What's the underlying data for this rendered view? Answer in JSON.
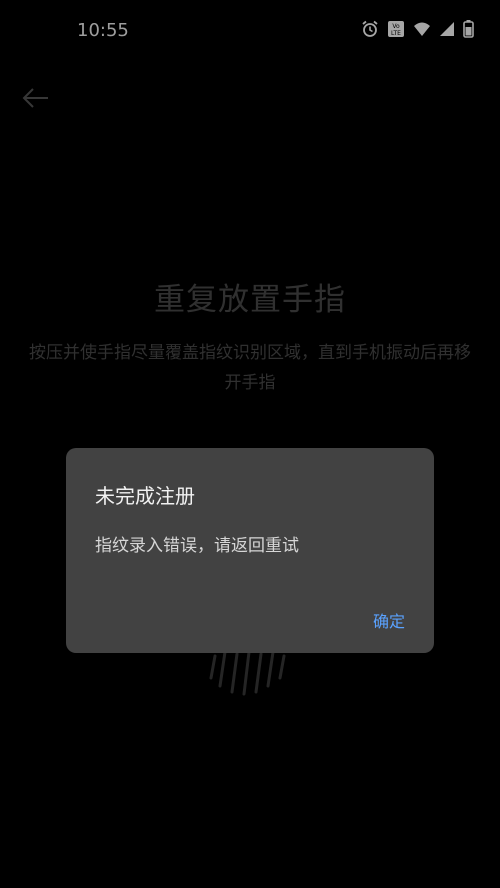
{
  "status_bar": {
    "time": "10:55",
    "icons": [
      "alarm-icon",
      "volte-icon",
      "wifi-icon",
      "cellular-signal-icon",
      "battery-icon"
    ],
    "volte_text": "Vo LTE"
  },
  "page": {
    "title": "重复放置手指",
    "subtitle": "按压并使手指尽量覆盖指纹识别区域，直到手机振动后再移开手指"
  },
  "dialog": {
    "title": "未完成注册",
    "message": "指纹录入错误，请返回重试",
    "ok_label": "确定"
  },
  "colors": {
    "background": "#000000",
    "dialog_bg": "#424242",
    "accent": "#5aa2ff",
    "dim_text": "#4a4a4a"
  }
}
